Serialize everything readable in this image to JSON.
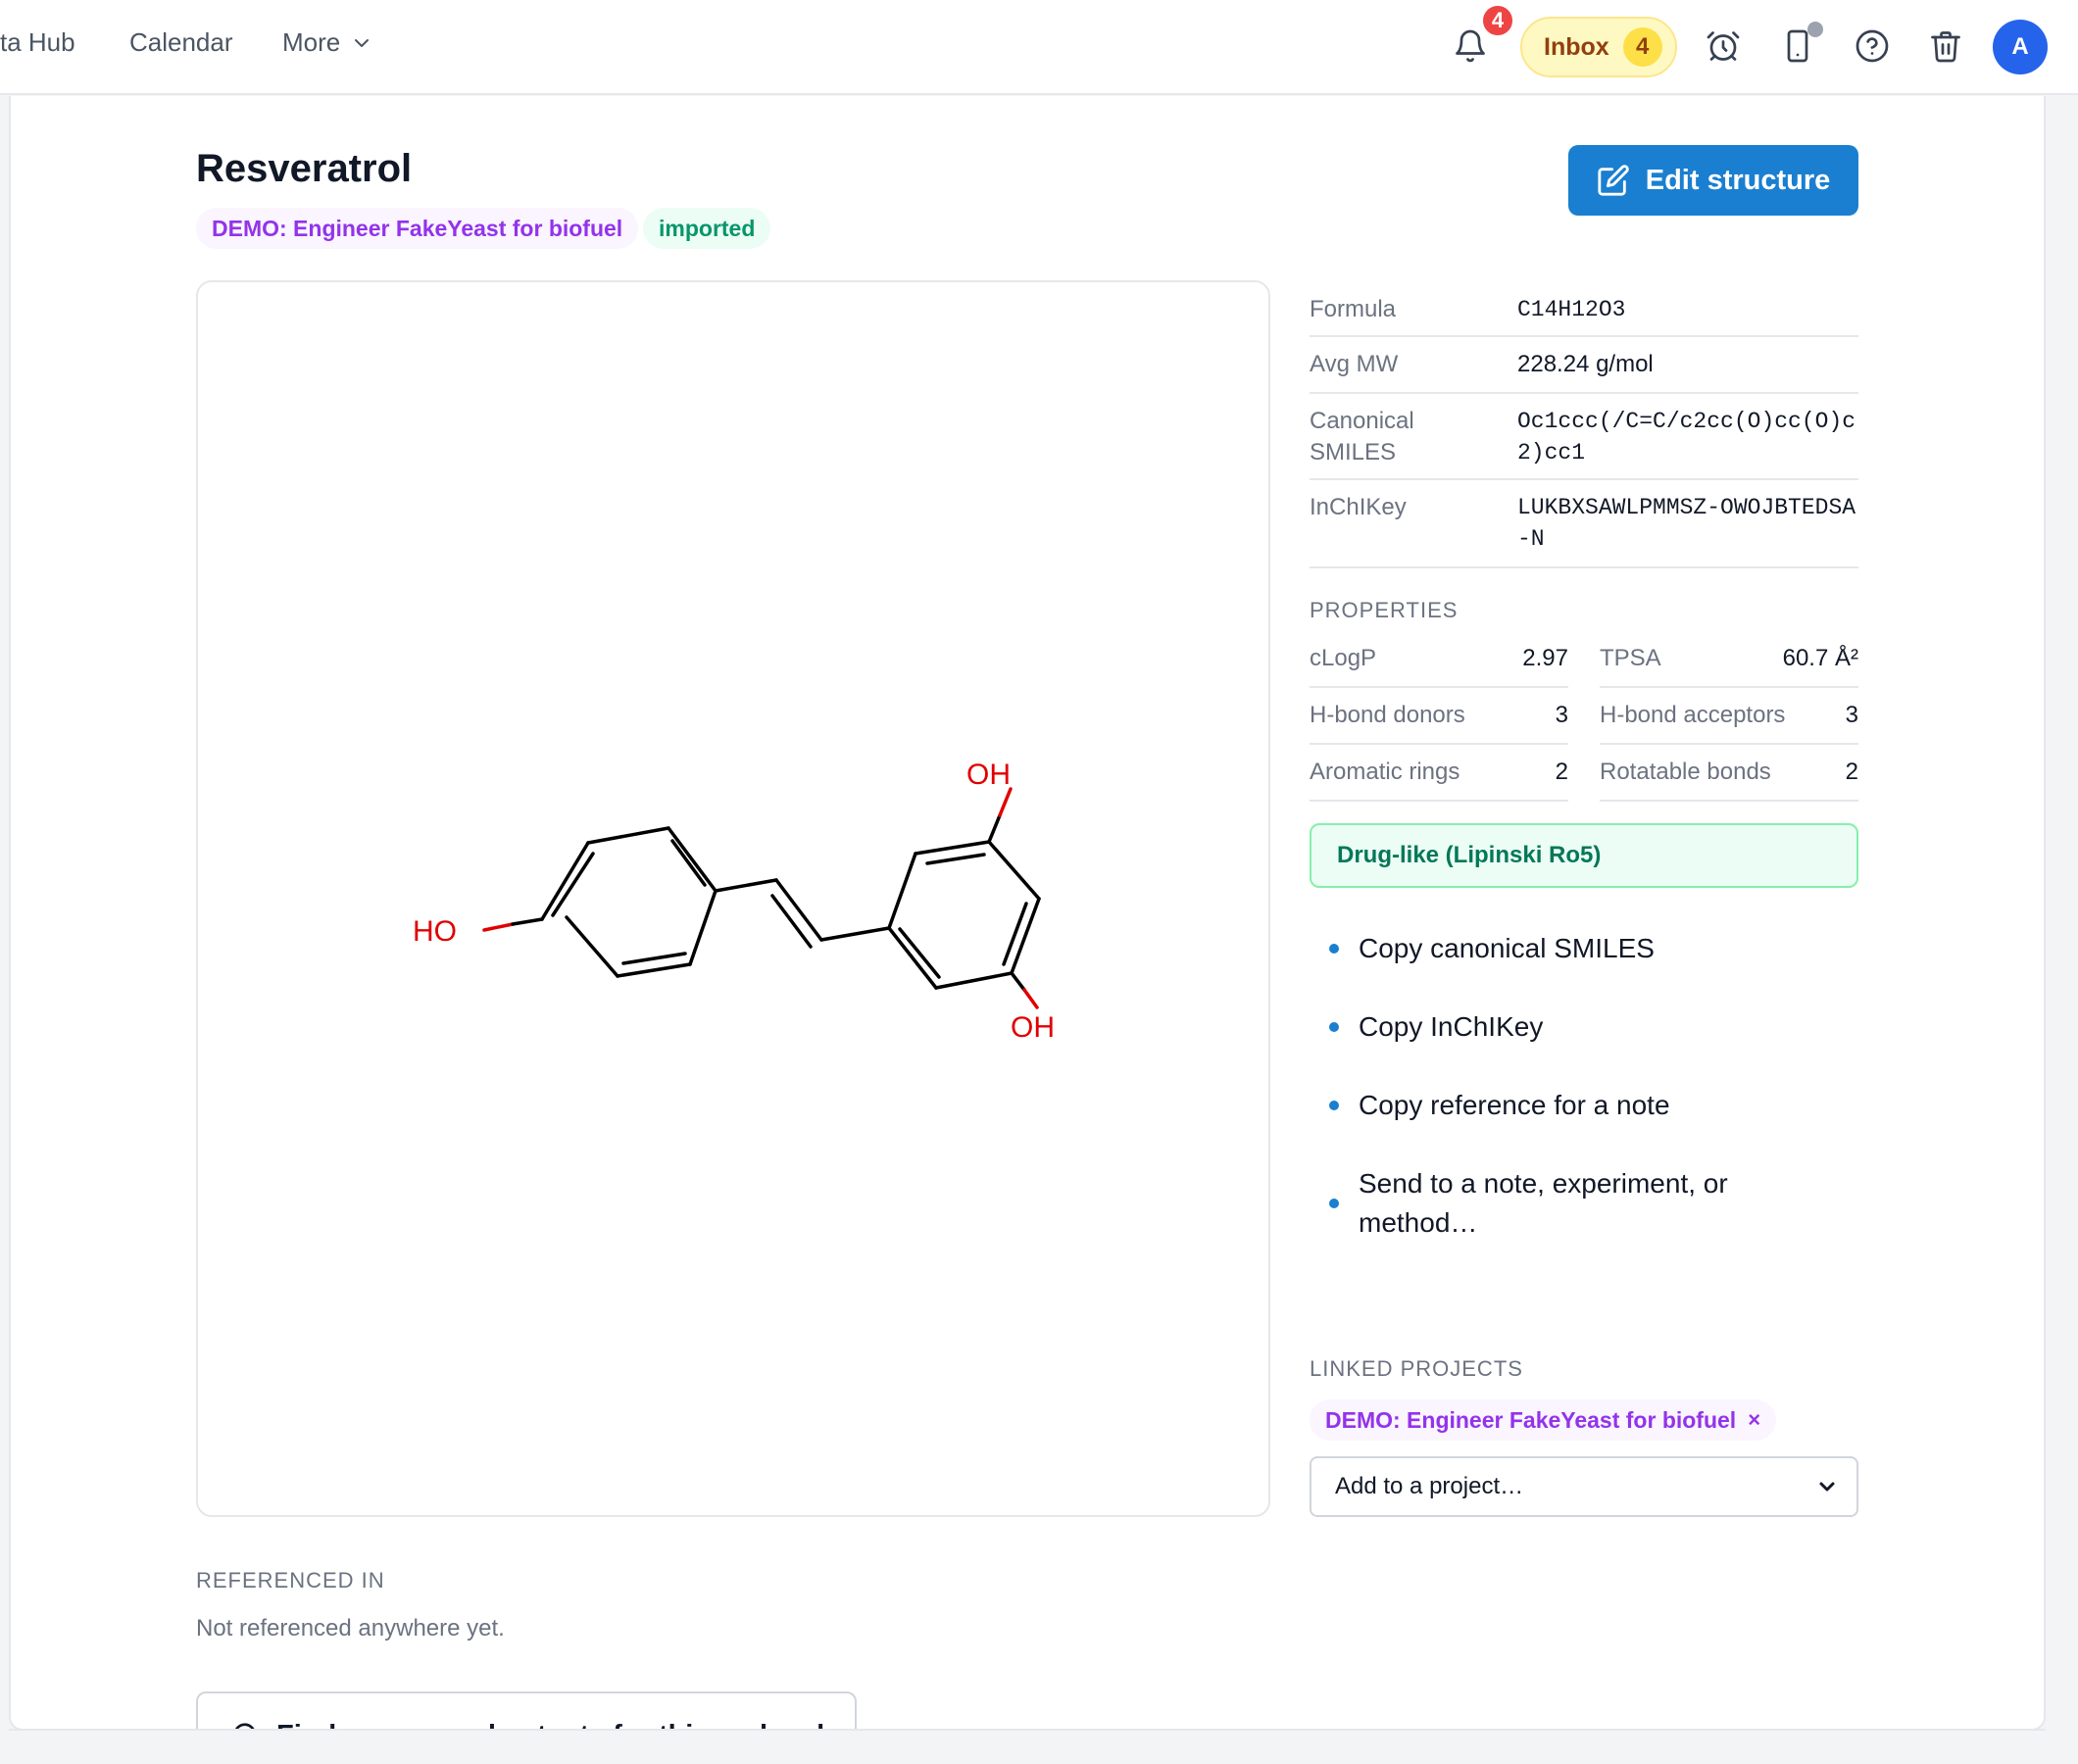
{
  "nav": {
    "items": [
      "ta Hub",
      "Calendar"
    ],
    "more_label": "More"
  },
  "header": {
    "notifications_count": "4",
    "inbox_label": "Inbox",
    "inbox_count": "4",
    "avatar_initial": "A"
  },
  "molecule": {
    "name": "Resveratrol",
    "tags": [
      "DEMO: Engineer FakeYeast for biofuel",
      "imported"
    ],
    "edit_button_label": "Edit structure",
    "structure_atom_labels": [
      "HO",
      "OH",
      "OH"
    ]
  },
  "identifiers": [
    {
      "key": "Formula",
      "value": "C14H12O3"
    },
    {
      "key": "Avg MW",
      "value": "228.24 g/mol"
    },
    {
      "key": "Canonical SMILES",
      "value": "Oc1ccc(/C=C/c2cc(O)cc(O)c2)cc1"
    },
    {
      "key": "InChIKey",
      "value": "LUKBXSAWLPMMSZ-OWOJBTEDSA-N"
    }
  ],
  "properties": {
    "label": "PROPERTIES",
    "items": [
      {
        "key": "cLogP",
        "value": "2.97"
      },
      {
        "key": "TPSA",
        "value": "60.7 Å²"
      },
      {
        "key": "H-bond donors",
        "value": "3"
      },
      {
        "key": "H-bond acceptors",
        "value": "3"
      },
      {
        "key": "Aromatic rings",
        "value": "2"
      },
      {
        "key": "Rotatable bonds",
        "value": "2"
      }
    ]
  },
  "druglike_badge": "Drug-like (Lipinski Ro5)",
  "actions": [
    "Copy canonical SMILES",
    "Copy InChIKey",
    "Copy reference for a note",
    "Send to a note, experiment, or method…"
  ],
  "linked_projects": {
    "label": "LINKED PROJECTS",
    "tags": [
      "DEMO: Engineer FakeYeast for biofuel"
    ],
    "remove_symbol": "×",
    "select_placeholder": "Add to a project…"
  },
  "referenced_in": {
    "label": "REFERENCED IN",
    "empty_text": "Not referenced anywhere yet.",
    "find_button_label": "Find papers and patents for this molecule"
  },
  "colors": {
    "primary": "#1a7fd0",
    "project_tag": "#9333ea",
    "success": "#059669",
    "heteroatom": "#e00000"
  }
}
